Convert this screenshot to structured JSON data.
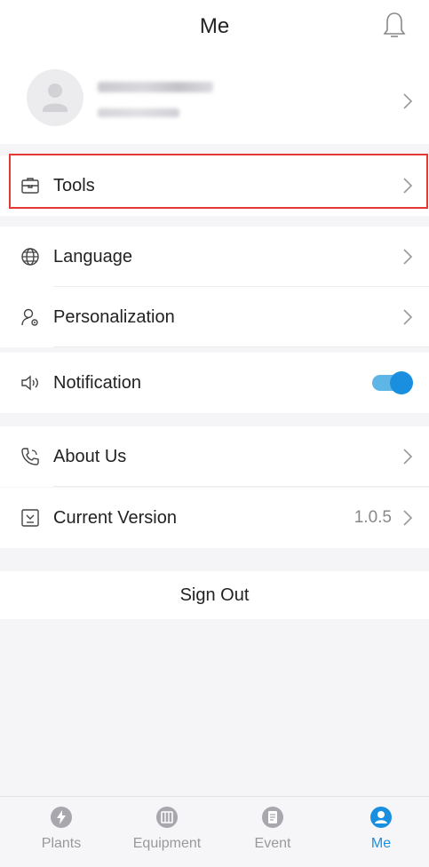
{
  "header": {
    "title": "Me",
    "bell_icon": "bell-icon"
  },
  "profile": {
    "name": "1556671889",
    "sub": "13557168"
  },
  "menu": {
    "tools": "Tools",
    "language": "Language",
    "personalization": "Personalization",
    "notification": "Notification",
    "about": "About Us",
    "version_label": "Current Version",
    "version_value": "1.0.5"
  },
  "notification_enabled": true,
  "signout": "Sign Out",
  "tabs": [
    {
      "label": "Plants",
      "icon": "bolt-icon"
    },
    {
      "label": "Equipment",
      "icon": "equipment-icon"
    },
    {
      "label": "Event",
      "icon": "event-icon"
    },
    {
      "label": "Me",
      "icon": "user-icon"
    }
  ],
  "colors": {
    "accent": "#1a8fe0",
    "highlight": "#e53935",
    "inactive": "#999999"
  }
}
